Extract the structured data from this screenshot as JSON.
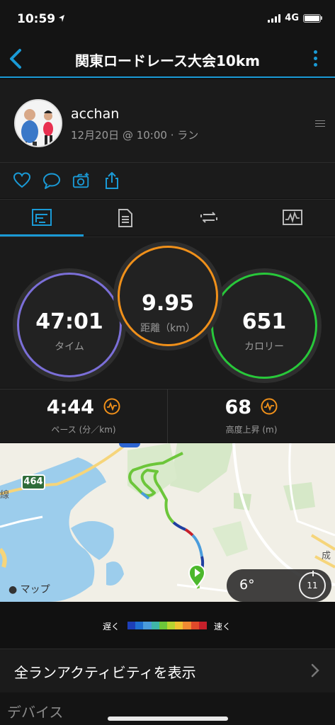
{
  "status_bar": {
    "time": "10:59",
    "network": "4G"
  },
  "nav": {
    "title": "関東ロードレース大会10km"
  },
  "profile": {
    "name": "acchan",
    "meta": "12月20日 @ 10:00 · ラン"
  },
  "stats": {
    "time": {
      "value": "47:01",
      "label": "タイム"
    },
    "distance": {
      "value": "9.95",
      "label": "距離（km）"
    },
    "calories": {
      "value": "651",
      "label": "カロリー"
    }
  },
  "metrics": {
    "pace": {
      "value": "4:44",
      "label": "ペース (分／km)"
    },
    "elevation": {
      "value": "68",
      "label": "高度上昇 (m)"
    }
  },
  "map": {
    "route_shield": "464",
    "label_left": "線",
    "label_right": "成",
    "attribution": "マップ"
  },
  "weather": {
    "temperature": "6°",
    "wind": "11"
  },
  "legend": {
    "slow": "遅く",
    "fast": "速く",
    "colors": [
      "#1d3fb8",
      "#1f6fd1",
      "#4a9cdc",
      "#3fb6a8",
      "#6cc63a",
      "#b8d330",
      "#f0c232",
      "#f08a32",
      "#e04a2a",
      "#c6202a"
    ]
  },
  "all_runs": {
    "label": "全ランアクティビティを表示"
  },
  "devices": {
    "label": "デバイス"
  },
  "colors": {
    "accent": "#1a9ad6",
    "time_ring": "#7b6fd8",
    "distance_ring": "#f0901a",
    "calorie_ring": "#28c83a",
    "metric_icon": "#f0901a"
  }
}
